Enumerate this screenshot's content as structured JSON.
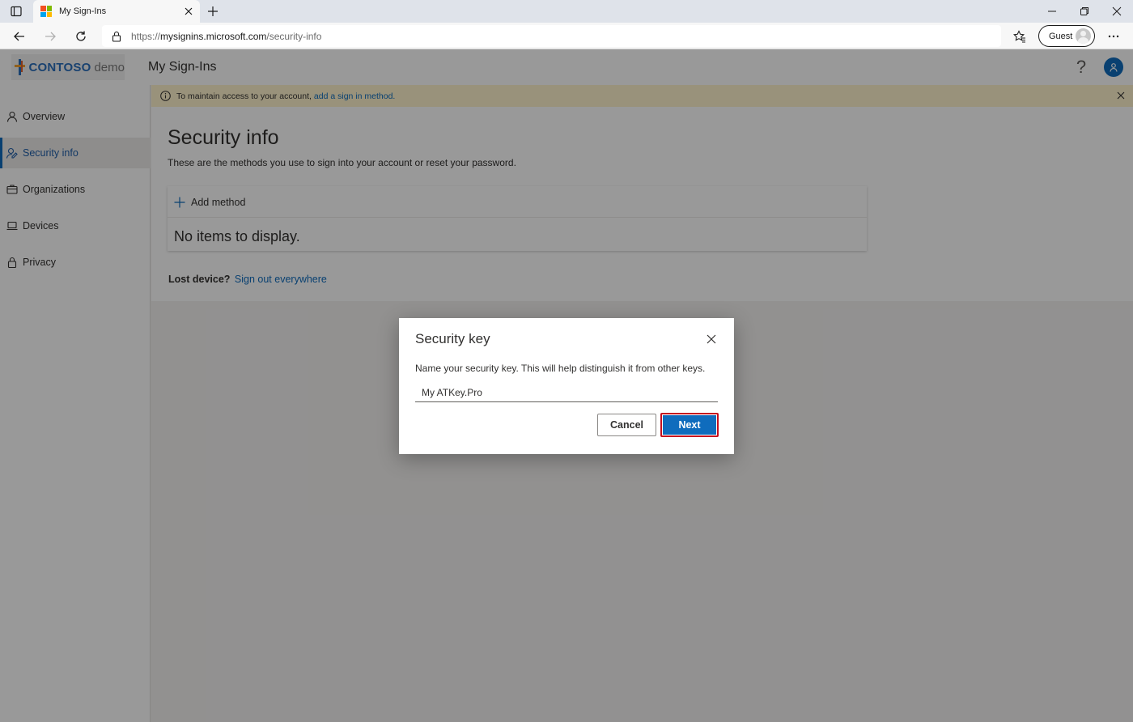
{
  "browser": {
    "tab_title": "My Sign-Ins",
    "url_prefix": "https://",
    "url_host": "mysignins.microsoft.com",
    "url_path": "/security-info",
    "guest_label": "Guest"
  },
  "header": {
    "brand_name": "CONTOSO",
    "brand_suffix": "demo",
    "app_title": "My Sign-Ins"
  },
  "sidebar": {
    "items": [
      {
        "label": "Overview",
        "icon": "person-icon",
        "active": false
      },
      {
        "label": "Security info",
        "icon": "security-info-icon",
        "active": true
      },
      {
        "label": "Organizations",
        "icon": "briefcase-icon",
        "active": false
      },
      {
        "label": "Devices",
        "icon": "laptop-icon",
        "active": false
      },
      {
        "label": "Privacy",
        "icon": "lock-icon",
        "active": false
      }
    ]
  },
  "banner": {
    "text": "To maintain access to your account,",
    "link": "add a sign in method."
  },
  "main": {
    "title": "Security info",
    "description": "These are the methods you use to sign into your account or reset your password.",
    "add_method_label": "Add method",
    "empty_text": "No items to display.",
    "lost_device_label": "Lost device?",
    "sign_out_link": "Sign out everywhere"
  },
  "dialog": {
    "title": "Security key",
    "description": "Name your security key. This will help distinguish it from other keys.",
    "input_value": "My ATKey.Pro",
    "cancel_label": "Cancel",
    "next_label": "Next"
  },
  "colors": {
    "accent": "#0f6cbd",
    "highlight_border": "#c50f1f",
    "banner_bg": "#fff4ce"
  }
}
